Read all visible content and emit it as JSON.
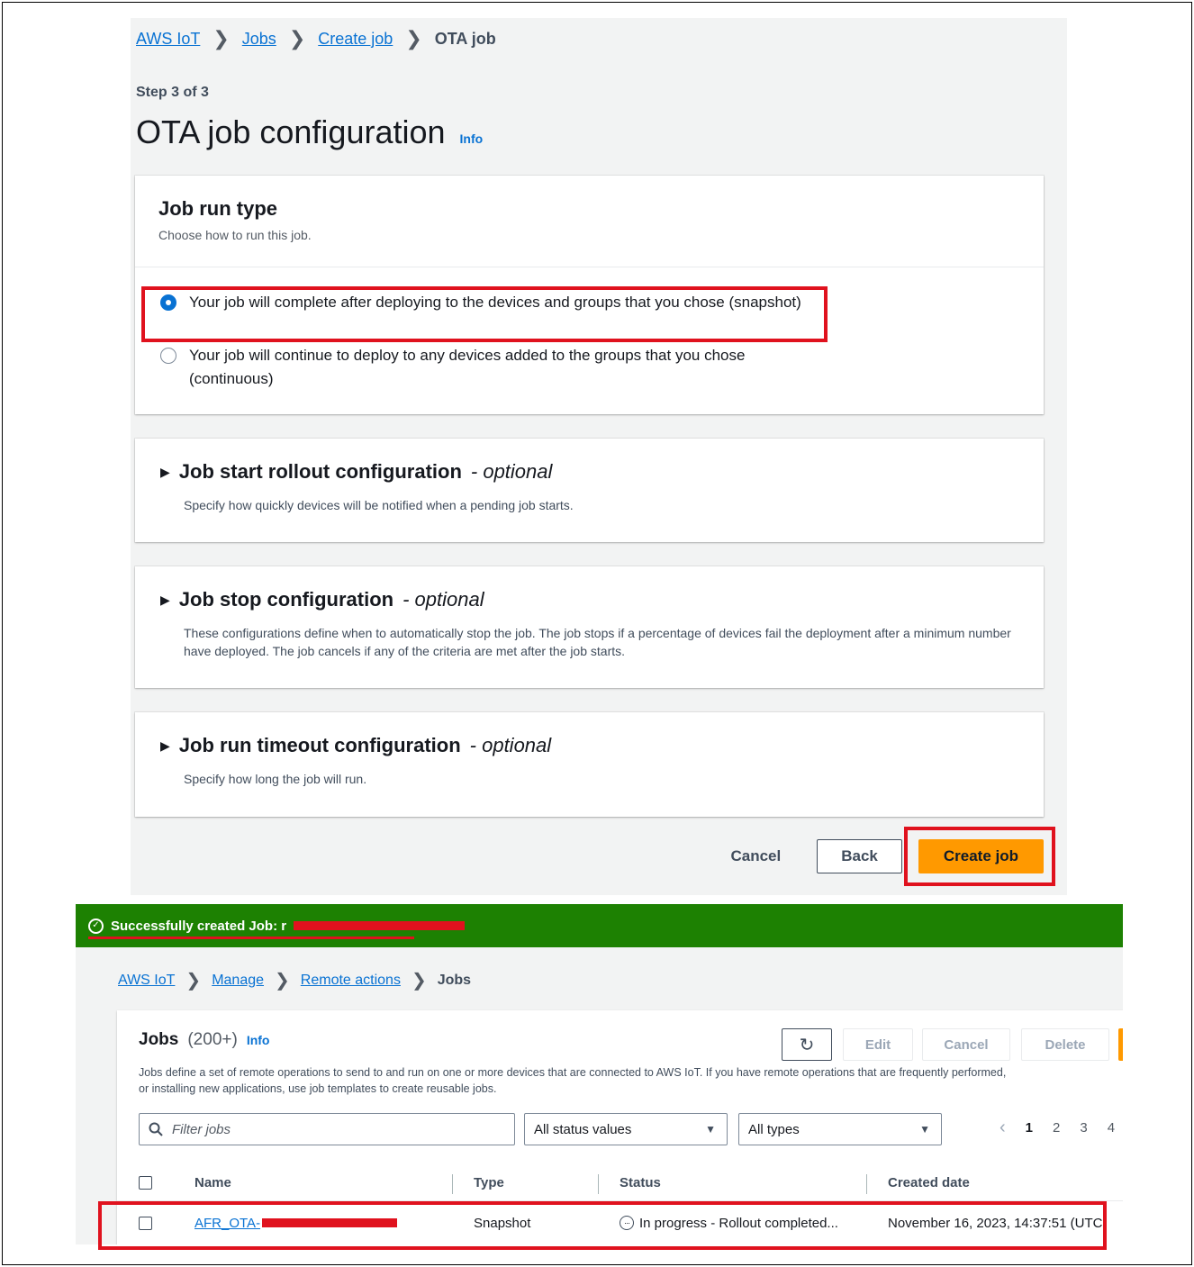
{
  "top": {
    "breadcrumb": [
      "AWS IoT",
      "Jobs",
      "Create job",
      "OTA job"
    ],
    "step": "Step 3 of 3",
    "title": "OTA job configuration",
    "info": "Info",
    "run_type": {
      "title": "Job run type",
      "desc": "Choose how to run this job.",
      "options": [
        {
          "label": "Your job will complete after deploying to the devices and groups that you chose (snapshot)",
          "selected": true
        },
        {
          "label": "Your job will continue to deploy to any devices added to the groups that you chose (continuous)",
          "selected": false
        }
      ]
    },
    "sections": [
      {
        "title": "Job start rollout configuration",
        "optional": "- optional",
        "desc": "Specify how quickly devices will be notified when a pending job starts."
      },
      {
        "title": "Job stop configuration",
        "optional": "- optional",
        "desc": "These configurations define when to automatically stop the job. The job stops if a percentage of devices fail the deployment after a minimum number have deployed. The job cancels if any of the criteria are met after the job starts."
      },
      {
        "title": "Job run timeout configuration",
        "optional": "- optional",
        "desc": "Specify how long the job will run."
      }
    ],
    "actions": {
      "cancel": "Cancel",
      "back": "Back",
      "create": "Create job"
    }
  },
  "bottom": {
    "flash": "Successfully created Job: r",
    "breadcrumb": [
      "AWS IoT",
      "Manage",
      "Remote actions",
      "Jobs"
    ],
    "jobs_title": "Jobs",
    "jobs_count": "(200+)",
    "info": "Info",
    "desc_line1": "Jobs define a set of remote operations to send to and run on one or more devices that are connected to AWS IoT. If you have remote operations that are frequently performed,",
    "desc_line2": "or installing new applications, use job templates to create reusable jobs.",
    "buttons": {
      "refresh": "↻",
      "edit": "Edit",
      "cancel": "Cancel",
      "delete": "Delete"
    },
    "filter_placeholder": "Filter jobs",
    "status_select": "All status values",
    "type_select": "All types",
    "pages": [
      "1",
      "2",
      "3",
      "4"
    ],
    "columns": [
      "Name",
      "Type",
      "Status",
      "Created date"
    ],
    "row": {
      "name": "AFR_OTA-",
      "type": "Snapshot",
      "status": "In progress - Rollout completed...",
      "created": "November 16, 2023, 14:37:51 (UTC"
    }
  },
  "colors": {
    "primary": "#ff9900",
    "link": "#0972d3",
    "success": "#1d8102",
    "highlight": "#e0121e"
  }
}
